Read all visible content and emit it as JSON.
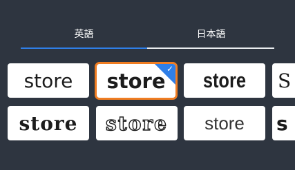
{
  "tabs": [
    {
      "label": "英語",
      "active": true
    },
    {
      "label": "日本語",
      "active": false
    }
  ],
  "fonts": [
    {
      "text": "store",
      "style": "sans-regular",
      "selected": false
    },
    {
      "text": "store",
      "style": "sans-bold",
      "selected": true
    },
    {
      "text": "store",
      "style": "condensed-heavy",
      "selected": false
    },
    {
      "text": "S",
      "style": "serif-partial",
      "selected": false
    },
    {
      "text": "store",
      "style": "blackletter-serif",
      "selected": false
    },
    {
      "text": "store",
      "style": "outline-slab",
      "selected": false
    },
    {
      "text": "store",
      "style": "thin-geometric",
      "selected": false
    },
    {
      "text": "s",
      "style": "bold-partial",
      "selected": false
    }
  ],
  "colors": {
    "background": "#2e3540",
    "accent": "#2f7fe8",
    "selection_border": "#f07d22",
    "tile": "#ffffff"
  },
  "icons": {
    "selected_badge": "checkmark-icon"
  }
}
